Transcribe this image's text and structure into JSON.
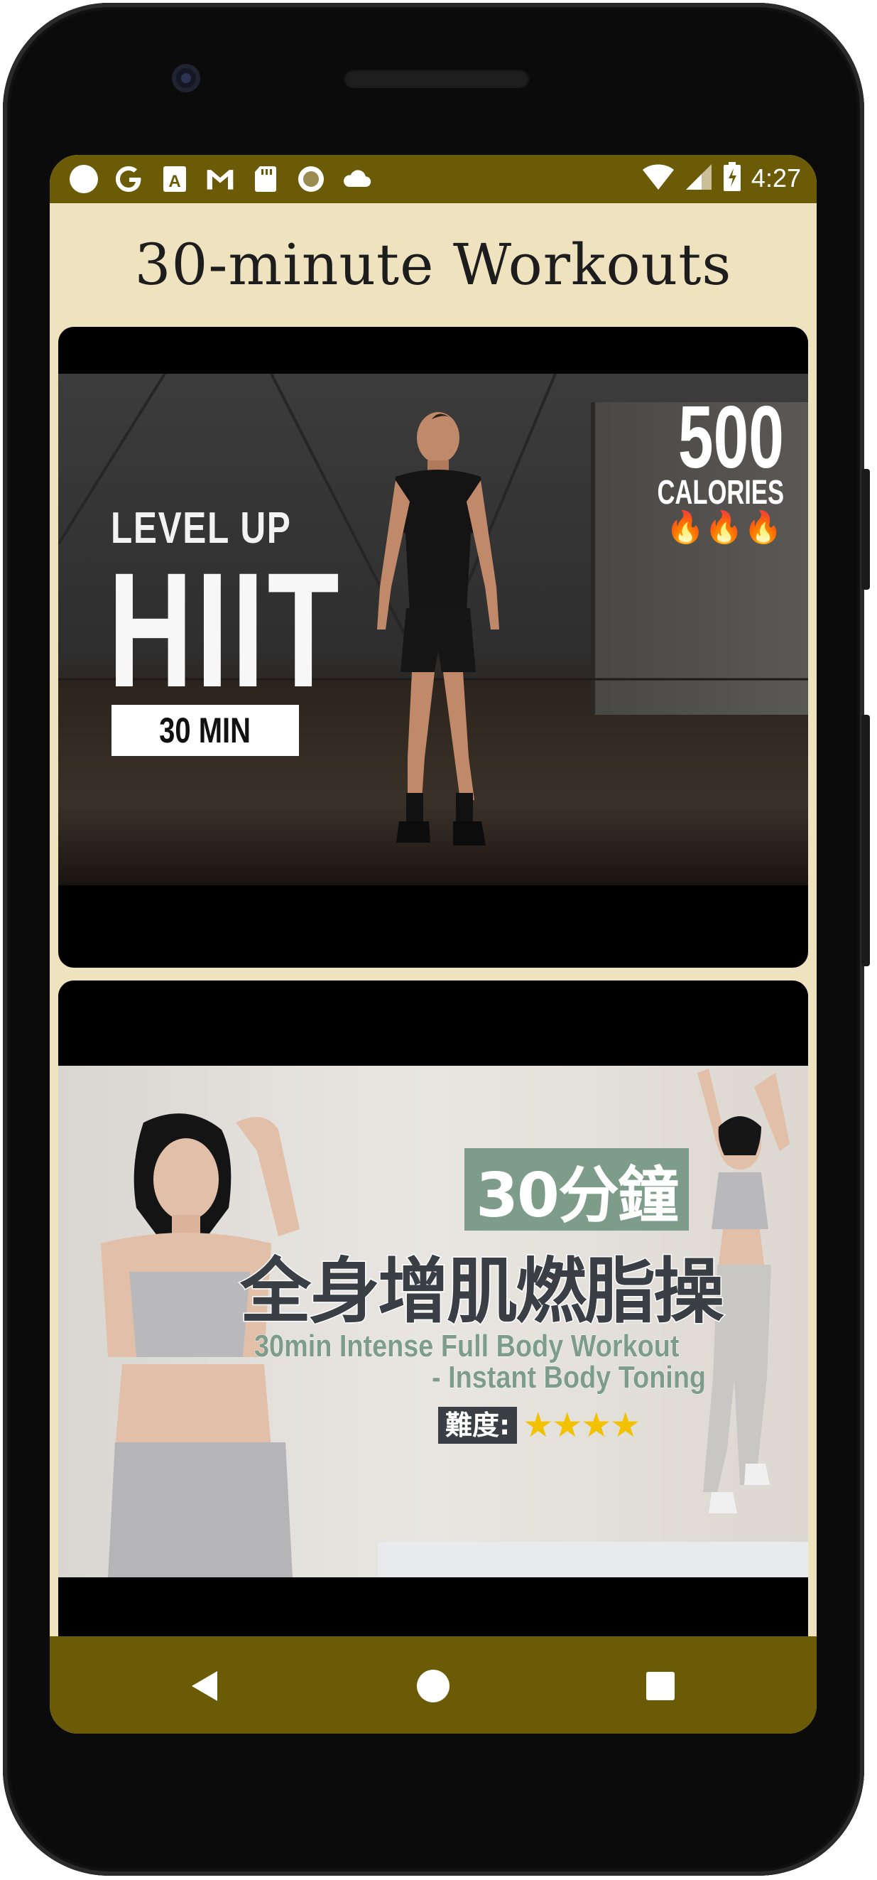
{
  "status_bar": {
    "time": "4:27",
    "left_icons": [
      "circle-icon",
      "google-icon",
      "font-a-icon",
      "gmail-icon",
      "sd-card-icon",
      "record-icon",
      "cloud-icon"
    ],
    "right_icons": [
      "wifi-icon",
      "signal-icon",
      "battery-charging-icon"
    ],
    "color": "#6b5b07"
  },
  "app": {
    "title": "30-minute Workouts",
    "background": "#efe3bf"
  },
  "videos": [
    {
      "overlay": {
        "line1": "LEVEL UP",
        "line2": "HIIT",
        "duration": "30 MIN",
        "calories_number": "500",
        "calories_label": "CALORIES",
        "flames": "🔥🔥🔥"
      }
    },
    {
      "overlay": {
        "tag": "30分鐘",
        "title_cn": "全身增肌燃脂操",
        "subtitle_line1": "30min Intense Full Body Workout",
        "subtitle_line2": "- Instant Body Toning",
        "difficulty_label": "難度:",
        "stars": "★★★★"
      }
    }
  ],
  "nav_bar": {
    "buttons": [
      "back-icon",
      "home-icon",
      "recents-icon"
    ]
  }
}
